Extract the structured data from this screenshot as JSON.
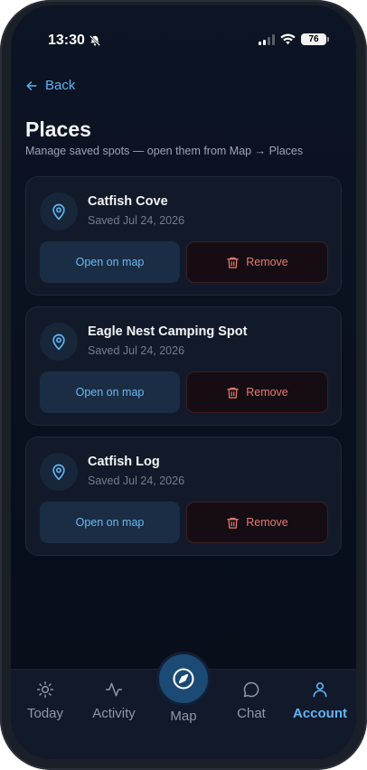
{
  "status_bar": {
    "time": "13:30",
    "battery": "76"
  },
  "header": {
    "back_label": "Back",
    "title": "Places",
    "subtitle": "Manage saved spots — open them from Map → Places"
  },
  "places": [
    {
      "name": "Catfish Cove",
      "saved": "Saved Jul 24, 2026",
      "open_label": "Open on map",
      "remove_label": "Remove"
    },
    {
      "name": "Eagle Nest Camping Spot",
      "saved": "Saved Jul 24, 2026",
      "open_label": "Open on map",
      "remove_label": "Remove"
    },
    {
      "name": "Catfish Log",
      "saved": "Saved Jul 24, 2026",
      "open_label": "Open on map",
      "remove_label": "Remove"
    }
  ],
  "tabbar": {
    "today": "Today",
    "activity": "Activity",
    "map": "Map",
    "chat": "Chat",
    "account": "Account",
    "active": "account"
  },
  "colors": {
    "accent": "#5fb4f1",
    "danger": "#e57c70",
    "background": "#0a111f",
    "card": "#121a29"
  }
}
